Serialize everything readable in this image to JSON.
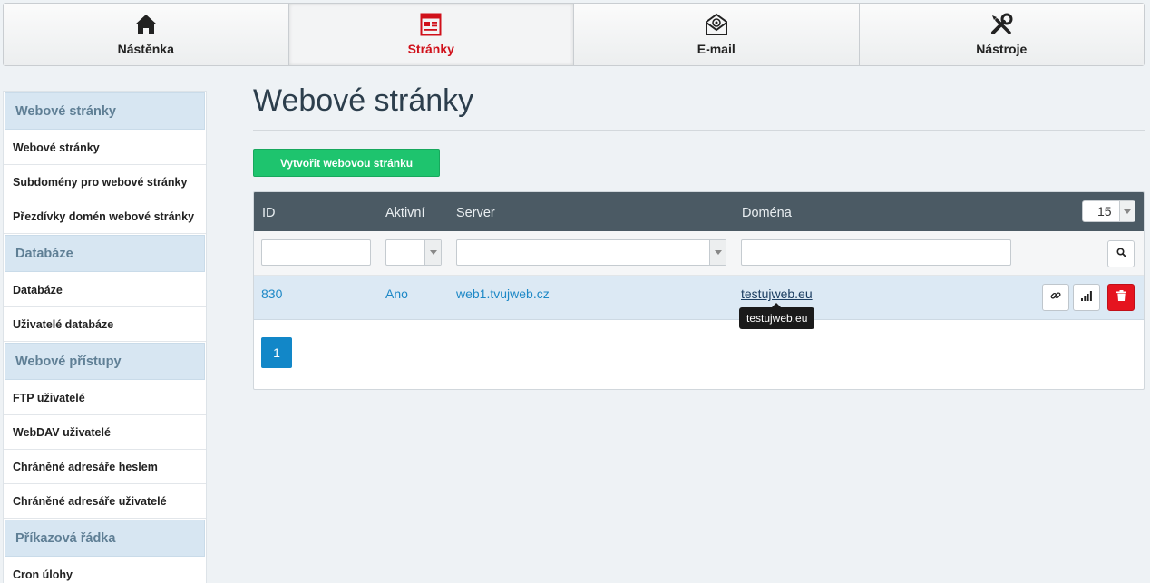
{
  "nav": {
    "tabs": [
      {
        "label": "Nástěnka",
        "icon": "home-icon"
      },
      {
        "label": "Stránky",
        "icon": "webpage-icon",
        "active": true
      },
      {
        "label": "E-mail",
        "icon": "email-icon"
      },
      {
        "label": "Nástroje",
        "icon": "tools-icon"
      }
    ]
  },
  "sidebar": {
    "sections": [
      {
        "heading": "Webové stránky",
        "items": [
          "Webové stránky",
          "Subdomény pro webové stránky",
          "Přezdívky domén webové stránky"
        ]
      },
      {
        "heading": "Databáze",
        "items": [
          "Databáze",
          "Uživatelé databáze"
        ]
      },
      {
        "heading": "Webové přístupy",
        "items": [
          "FTP uživatelé",
          "WebDAV uživatelé",
          "Chráněné adresáře heslem",
          "Chráněné adresáře uživatelé"
        ]
      },
      {
        "heading": "Příkazová řádka",
        "items": [
          "Cron úlohy"
        ]
      }
    ]
  },
  "main": {
    "title": "Webové stránky",
    "create_button": "Vytvořit webovou stránku",
    "table": {
      "columns": [
        "ID",
        "Aktivní",
        "Server",
        "Doména"
      ],
      "per_page": "15",
      "rows": [
        {
          "id": "830",
          "active": "Ano",
          "server": "web1.tvujweb.cz",
          "domain": "testujweb.eu"
        }
      ],
      "tooltip": "testujweb.eu",
      "current_page": "1"
    }
  },
  "colors": {
    "accent_red": "#d0101a",
    "header_bg": "#4b5a64",
    "create_green": "#1ec46e",
    "link_blue": "#1d88c6",
    "delete_red": "#e5141f"
  }
}
